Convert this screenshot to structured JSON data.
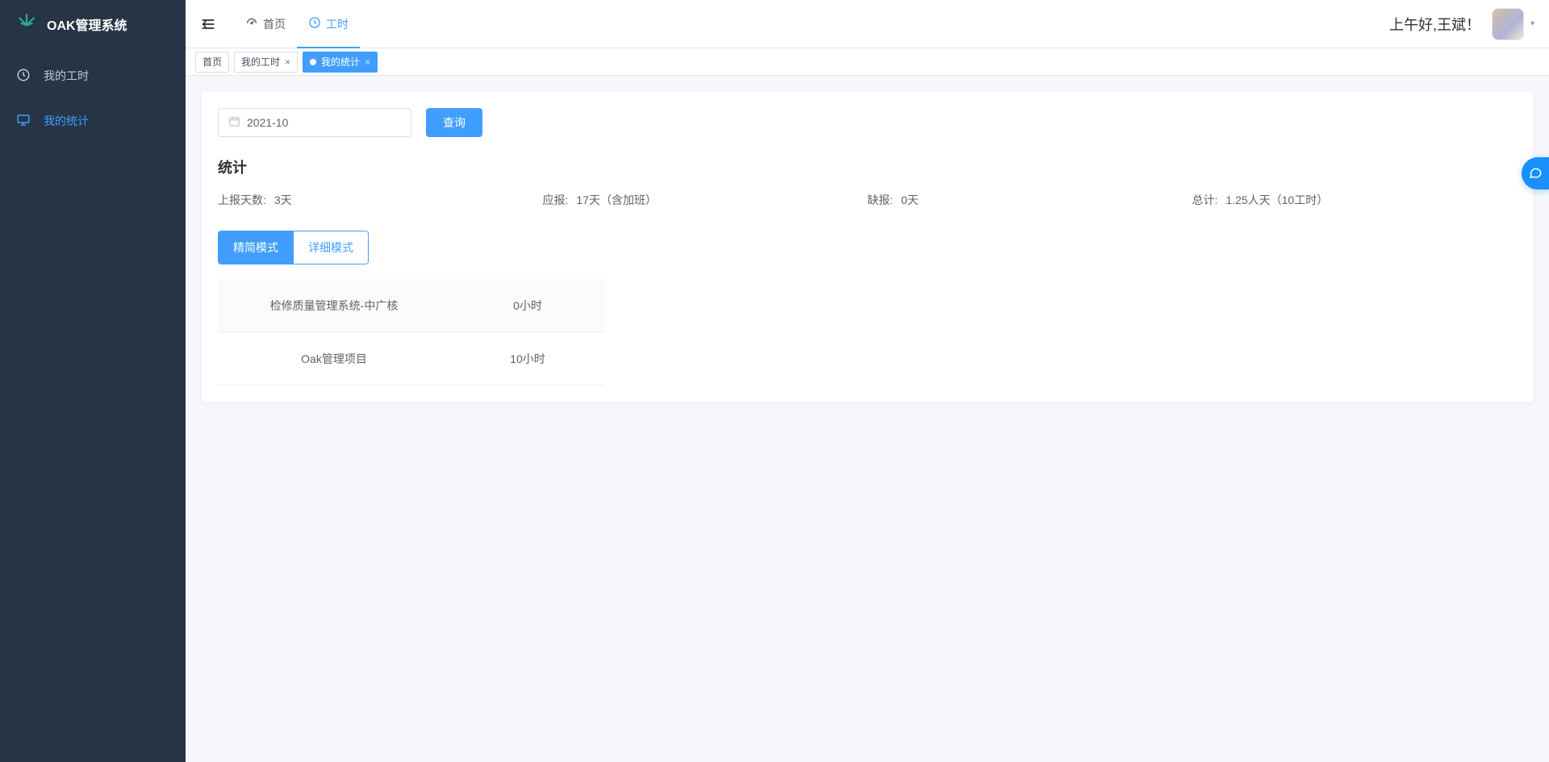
{
  "app": {
    "title": "OAK管理系统"
  },
  "sidebar": {
    "items": [
      {
        "label": "我的工时",
        "icon": "clock"
      },
      {
        "label": "我的统计",
        "icon": "monitor"
      }
    ],
    "activeIndex": 1
  },
  "header": {
    "tabs": [
      {
        "label": "首页",
        "icon": "dashboard"
      },
      {
        "label": "工时",
        "icon": "clock"
      }
    ],
    "activeTabIndex": 1,
    "greeting": "上午好,王斌！"
  },
  "viewTags": [
    {
      "label": "首页",
      "closable": false,
      "active": false
    },
    {
      "label": "我的工时",
      "closable": true,
      "active": false
    },
    {
      "label": "我的统计",
      "closable": true,
      "active": true
    }
  ],
  "filter": {
    "month": "2021-10",
    "queryLabel": "查询"
  },
  "stats": {
    "title": "统计",
    "items": [
      {
        "label": "上报天数:",
        "value": "3天"
      },
      {
        "label": "应报:",
        "value": "17天（含加班）"
      },
      {
        "label": "缺报:",
        "value": "0天"
      },
      {
        "label": "总计:",
        "value": "1.25人天（10工时）"
      }
    ]
  },
  "modeTabs": {
    "simple": "精简模式",
    "detail": "详细模式",
    "active": "simple"
  },
  "projectHours": [
    {
      "name": "检修质量管理系统-中广核",
      "hours": "0小时"
    },
    {
      "name": "Oak管理项目",
      "hours": "10小时"
    }
  ]
}
